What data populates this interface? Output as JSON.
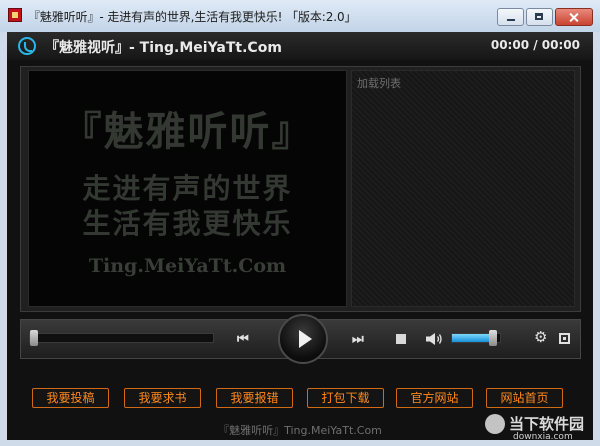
{
  "window": {
    "title": "『魅雅听听』- 走进有声的世界,生活有我更快乐! 「版本:2.0」"
  },
  "header": {
    "title": "『魅雅视听』- Ting.MeiYaTt.Com",
    "time": "00:00 / 00:00"
  },
  "video": {
    "line1": "『魅雅听听』",
    "line2": "走进有声的世界",
    "line3": "生活有我更快乐",
    "line4": "Ting.MeiYaTt.Com"
  },
  "playlist": {
    "label": "加载列表"
  },
  "controls": {
    "prev_label": "⏮",
    "next_label": "⏭",
    "seek_progress": 0.02,
    "volume": 0.85,
    "gear_label": "⚙"
  },
  "links": [
    {
      "label": "我要投稿"
    },
    {
      "label": "我要求书"
    },
    {
      "label": "我要报错"
    },
    {
      "label": "打包下载"
    },
    {
      "label": "官方网站"
    },
    {
      "label": "网站首页"
    }
  ],
  "footer": {
    "text": "『魅雅听听』Ting.MeiYaTt.Com"
  },
  "watermark": {
    "text": "当下软件园",
    "sub": "downxia.com"
  },
  "colors": {
    "accent": "#28b7e8",
    "link": "#ff8a1c"
  }
}
